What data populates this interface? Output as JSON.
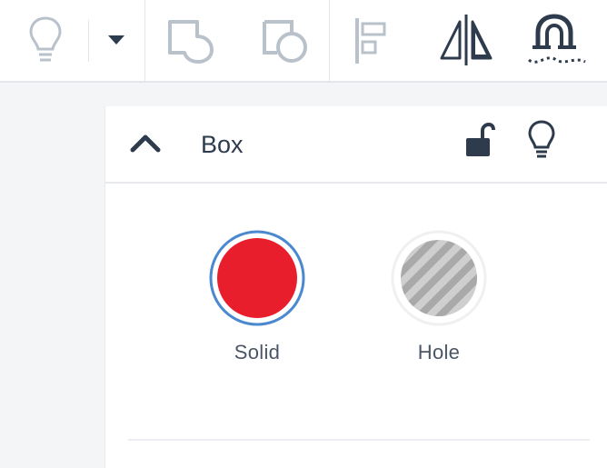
{
  "toolbar": {
    "buttons": [
      {
        "name": "light-bulb-icon",
        "enabled": false
      },
      {
        "name": "chevron-down-icon",
        "enabled": true
      },
      {
        "name": "group-icon",
        "enabled": false
      },
      {
        "name": "ungroup-icon",
        "enabled": false
      },
      {
        "name": "align-icon",
        "enabled": false
      },
      {
        "name": "mirror-icon",
        "enabled": true
      },
      {
        "name": "magnet-icon",
        "enabled": true
      }
    ]
  },
  "panel": {
    "title": "Box",
    "collapse_icon": "chevron-up-icon",
    "lock_icon": "unlocked-padlock-icon",
    "visibility_icon": "light-bulb-icon",
    "options": [
      {
        "label": "Solid",
        "color": "#e91e2c",
        "selected": true
      },
      {
        "label": "Hole",
        "pattern": "diagonal-stripes",
        "selected": false
      }
    ]
  },
  "colors": {
    "accent_blue": "#4a88cf",
    "solid_red": "#e91e2c",
    "icon_dark": "#2e3b4d",
    "icon_disabled": "#b9c1cb"
  }
}
